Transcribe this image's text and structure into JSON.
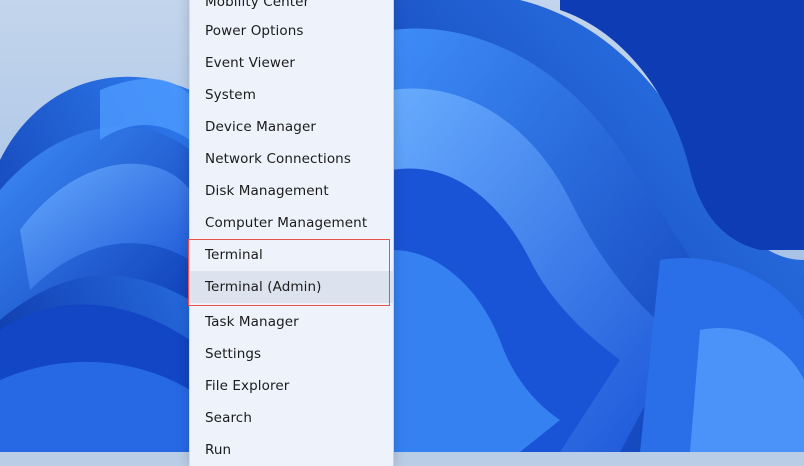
{
  "menu": {
    "items": [
      {
        "label": "Mobility Center"
      },
      {
        "label": "Power Options"
      },
      {
        "label": "Event Viewer"
      },
      {
        "label": "System"
      },
      {
        "label": "Device Manager"
      },
      {
        "label": "Network Connections"
      },
      {
        "label": "Disk Management"
      },
      {
        "label": "Computer Management"
      },
      {
        "label": "Terminal"
      },
      {
        "label": "Terminal (Admin)"
      },
      {
        "label": "Task Manager"
      },
      {
        "label": "Settings"
      },
      {
        "label": "File Explorer"
      },
      {
        "label": "Search"
      },
      {
        "label": "Run"
      }
    ]
  },
  "colors": {
    "menu_background": "#eef2fb",
    "hover_background": "#dde3ee",
    "highlight_border": "#e8524a",
    "wallpaper_blue": "#1f5fe0"
  }
}
